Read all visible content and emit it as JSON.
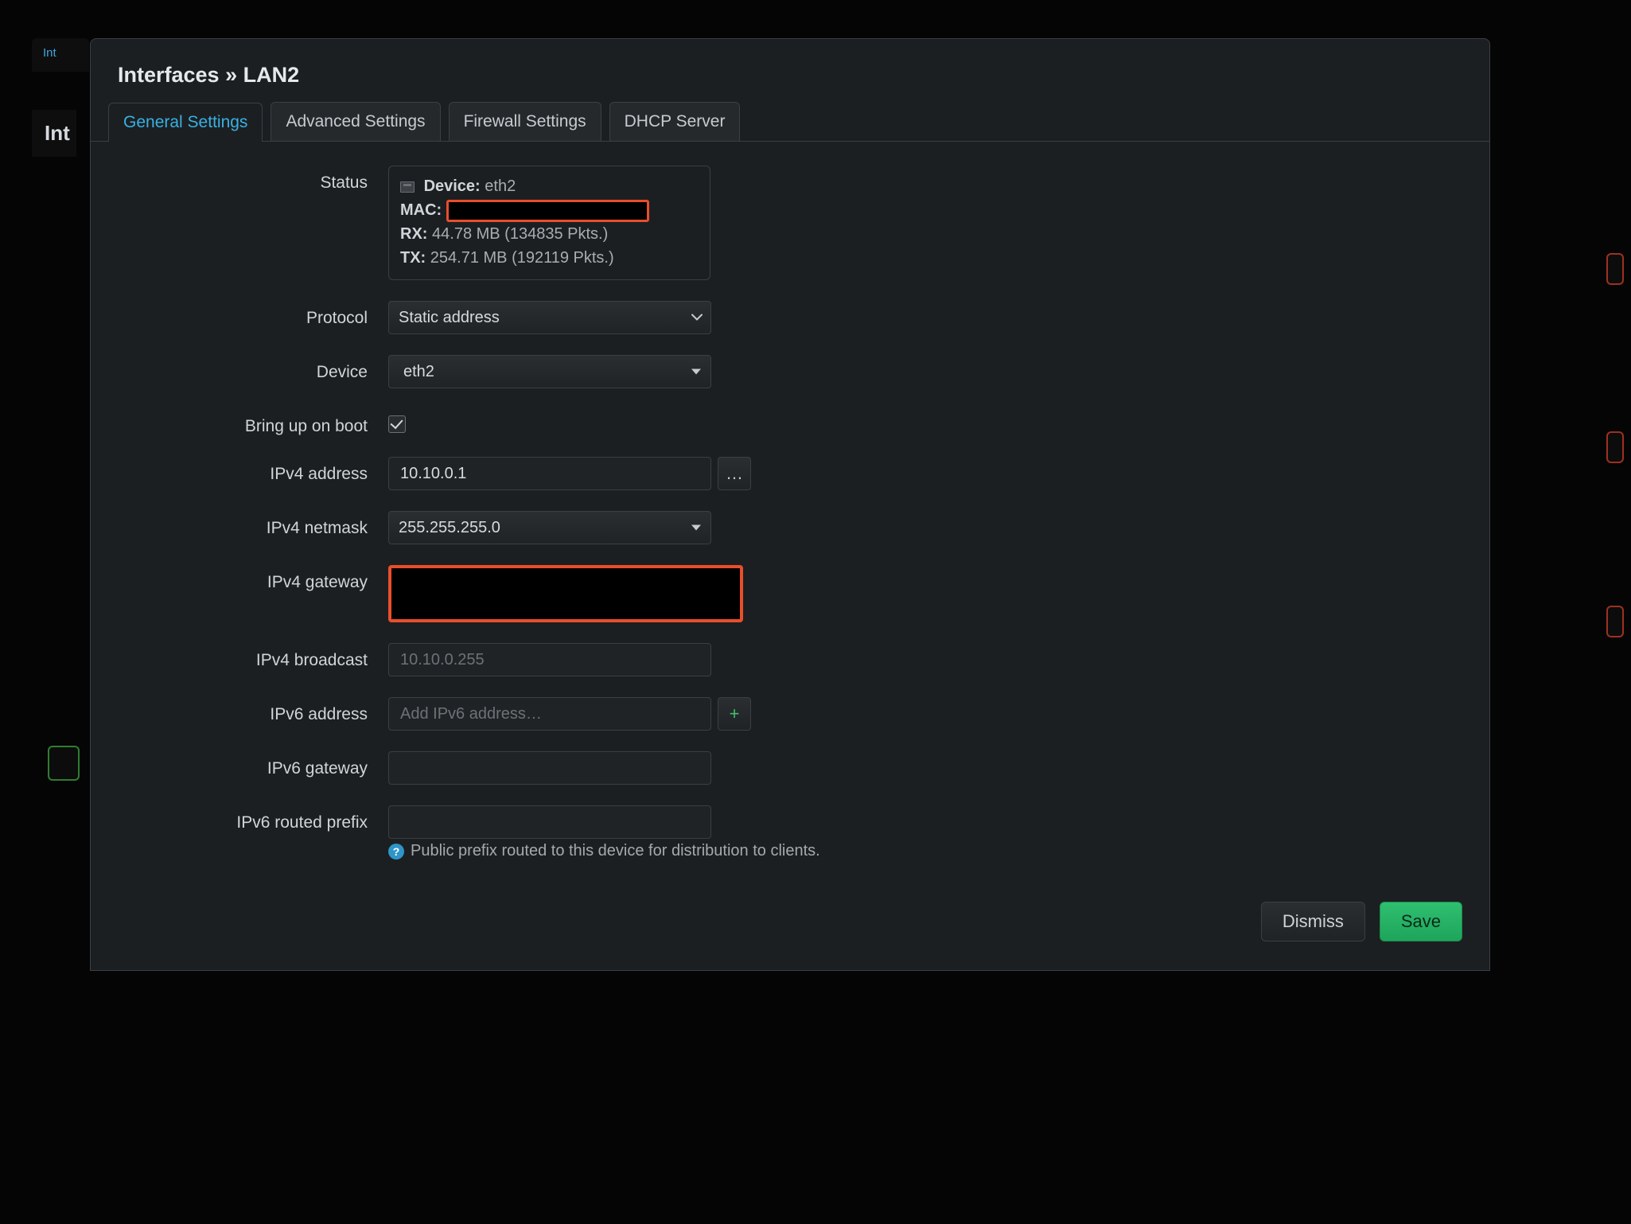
{
  "background": {
    "tab_fragment": "Int",
    "title_fragment": "Int"
  },
  "modal": {
    "title": "Interfaces » LAN2",
    "tabs": [
      {
        "id": "general",
        "label": "General Settings"
      },
      {
        "id": "advanced",
        "label": "Advanced Settings"
      },
      {
        "id": "firewall",
        "label": "Firewall Settings"
      },
      {
        "id": "dhcp",
        "label": "DHCP Server"
      }
    ],
    "active_tab": "general",
    "status": {
      "label": "Status",
      "device_label": "Device:",
      "device_value": "eth2",
      "mac_label": "MAC:",
      "rx_label": "RX:",
      "rx_value": "44.78 MB (134835 Pkts.)",
      "tx_label": "TX:",
      "tx_value": "254.71 MB (192119 Pkts.)"
    },
    "fields": {
      "protocol": {
        "label": "Protocol",
        "value": "Static address"
      },
      "device": {
        "label": "Device",
        "value": "eth2"
      },
      "bring_up": {
        "label": "Bring up on boot",
        "checked": true
      },
      "ipv4_address": {
        "label": "IPv4 address",
        "value": "10.10.0.1",
        "side_button": "…"
      },
      "ipv4_netmask": {
        "label": "IPv4 netmask",
        "value": "255.255.255.0"
      },
      "ipv4_gateway": {
        "label": "IPv4 gateway"
      },
      "ipv4_broadcast": {
        "label": "IPv4 broadcast",
        "value": "",
        "placeholder": "10.10.0.255"
      },
      "ipv6_address": {
        "label": "IPv6 address",
        "value": "",
        "placeholder": "Add IPv6 address…",
        "side_button": "+"
      },
      "ipv6_gateway": {
        "label": "IPv6 gateway",
        "value": ""
      },
      "ipv6_prefix": {
        "label": "IPv6 routed prefix",
        "value": "",
        "help": "Public prefix routed to this device for distribution to clients."
      }
    },
    "footer": {
      "dismiss": "Dismiss",
      "save": "Save"
    }
  },
  "colors": {
    "accent": "#38b0e4",
    "highlight": "#e94e2b",
    "save_btn": "#2fbf71"
  }
}
